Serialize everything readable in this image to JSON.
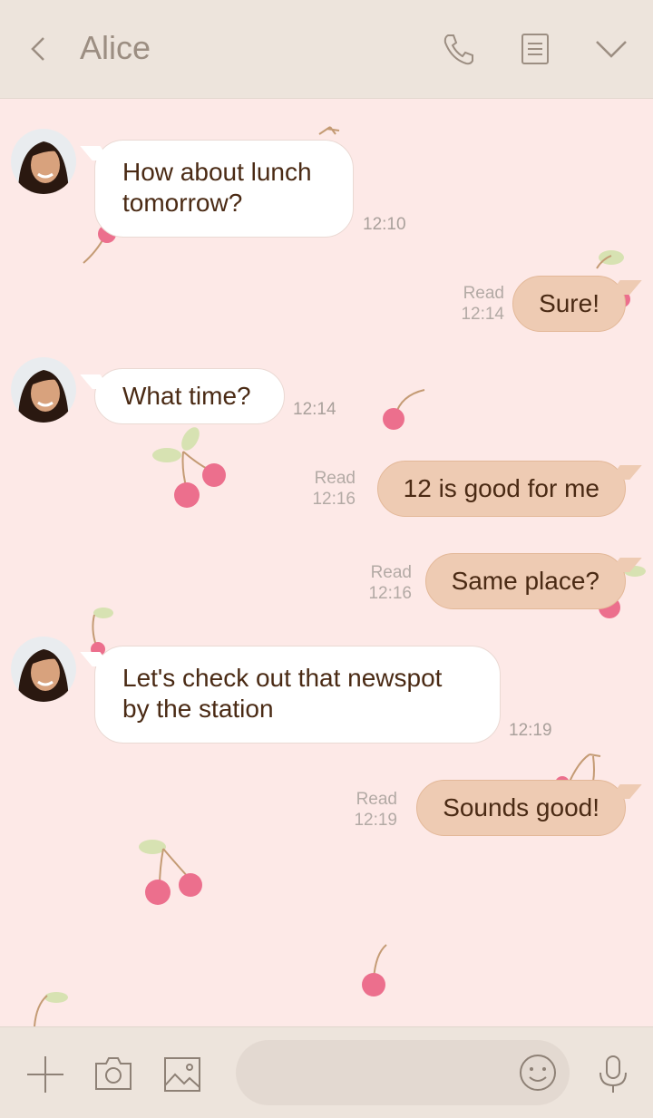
{
  "header": {
    "title": "Alice",
    "icons": [
      "back-arrow-icon",
      "phone-icon",
      "notes-icon",
      "chevron-down-icon"
    ]
  },
  "messages": [
    {
      "side": "in",
      "text_lines": [
        "How about lunch",
        "tomorrow?"
      ],
      "time": "12:10"
    },
    {
      "side": "out",
      "text": "Sure!",
      "status": "Read",
      "time": "12:14"
    },
    {
      "side": "in",
      "text": "What time?",
      "time": "12:14"
    },
    {
      "side": "out",
      "text": "12 is good for me",
      "status": "Read",
      "time": "12:16"
    },
    {
      "side": "out",
      "text": "Same place?",
      "status": "Read",
      "time": "12:16"
    },
    {
      "side": "in",
      "text_lines": [
        "Let's check out that newspot",
        "by the station"
      ],
      "time": "12:19"
    },
    {
      "side": "out",
      "text": "Sounds good!",
      "status": "Read",
      "time": "12:19"
    }
  ],
  "footer": {
    "icons": [
      "plus-icon",
      "camera-icon",
      "image-icon",
      "emoji-icon",
      "microphone-icon"
    ],
    "input_placeholder": ""
  },
  "colors": {
    "background": "#fde9e7",
    "header": "#ede4dc",
    "bubble_in": "#ffffff",
    "bubble_out": "#eecbb3",
    "text": "#4a2a14",
    "cherry": "#ec6f8d",
    "leaf": "#d7e2b2"
  }
}
